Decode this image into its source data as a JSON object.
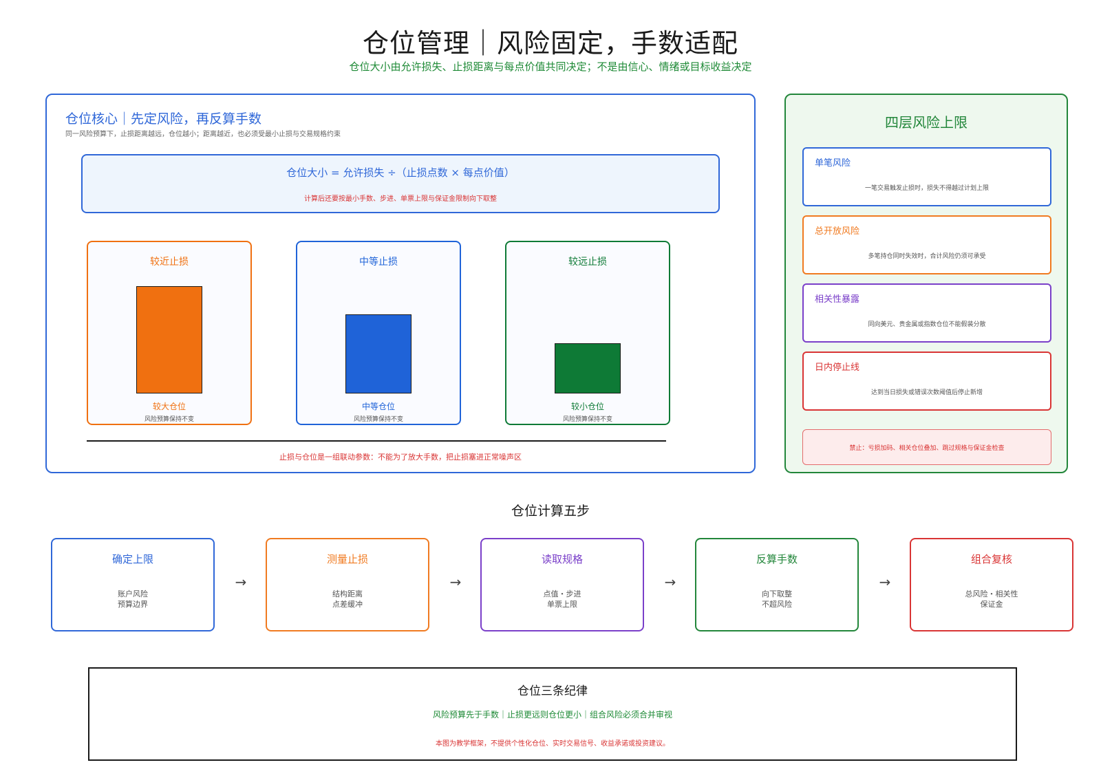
{
  "title": "仓位管理｜风险固定，手数适配",
  "subtitle": "仓位大小由允许损失、止损距离与每点价值共同决定；不是由信心、情绪或目标收益决定",
  "core": {
    "title": "仓位核心｜先定风险，再反算手数",
    "description": "同一风险预算下，止损距离越远，仓位越小；距离越近，也必须受最小止损与交易规格约束",
    "formula": "仓位大小 = 允许损失 ÷（止损点数 × 每点价值）",
    "formula_note": "计算后还要按最小手数、步进、单票上限与保证金限制向下取整",
    "cards": [
      {
        "title": "较近止损",
        "label": "较大仓位",
        "note": "风险预算保持不变",
        "relative_size": 1.0,
        "color": "#f07010"
      },
      {
        "title": "中等止损",
        "label": "中等仓位",
        "note": "风险预算保持不变",
        "relative_size": 0.74,
        "color": "#1f63d8"
      },
      {
        "title": "较远止损",
        "label": "较小仓位",
        "note": "风险预算保持不变",
        "relative_size": 0.47,
        "color": "#0e7a36"
      }
    ],
    "footnote": "止损与仓位是一组联动参数：不能为了放大手数，把止损塞进正常噪声区"
  },
  "risk_limits": {
    "title": "四层风险上限",
    "items": [
      {
        "name": "单笔风险",
        "desc": "一笔交易触发止损时，损失不得越过计划上限",
        "color": "#2f67d8"
      },
      {
        "name": "总开放风险",
        "desc": "多笔持仓同时失效时，合计风险仍须可承受",
        "color": "#f07a20"
      },
      {
        "name": "相关性暴露",
        "desc": "同向美元、贵金属或指数仓位不能假装分散",
        "color": "#7a3fc9"
      },
      {
        "name": "日内停止线",
        "desc": "达到当日损失或错误次数阈值后停止新增",
        "color": "#d93434"
      }
    ],
    "forbidden": "禁止：亏损加码、相关仓位叠加、跳过规格与保证金检查"
  },
  "steps": {
    "title": "仓位计算五步",
    "items": [
      {
        "title": "确定上限",
        "line1": "账户风险",
        "line2": "预算边界",
        "color": "#2f67d8"
      },
      {
        "title": "测量止损",
        "line1": "结构距离",
        "line2": "点差缓冲",
        "color": "#f07a20"
      },
      {
        "title": "读取规格",
        "line1": "点值・步进",
        "line2": "单票上限",
        "color": "#7a3fc9"
      },
      {
        "title": "反算手数",
        "line1": "向下取整",
        "line2": "不超风险",
        "color": "#22863a"
      },
      {
        "title": "组合复核",
        "line1": "总风险・相关性",
        "line2": "保证金",
        "color": "#d93434"
      }
    ],
    "arrow": "→"
  },
  "discipline": {
    "title": "仓位三条纪律",
    "rules": "风险预算先于手数｜止损更远则仓位更小｜组合风险必须合并审视",
    "note": "本图为教学框架，不提供个性化仓位、实时交易信号、收益承诺或投资建议。"
  }
}
